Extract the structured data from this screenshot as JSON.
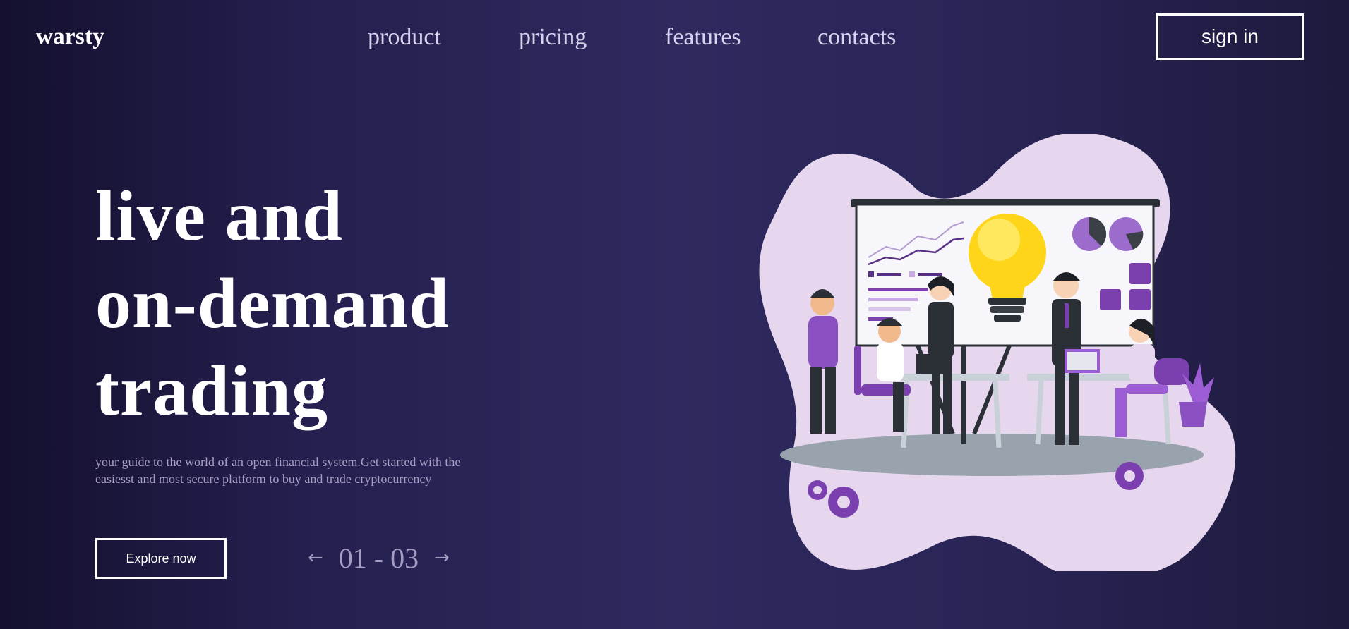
{
  "header": {
    "logo": "warsty",
    "nav": [
      "product",
      "pricing",
      "features",
      "contacts"
    ],
    "signin_label": "sign in"
  },
  "hero": {
    "title_lines": [
      "live and",
      "on-demand",
      "trading"
    ],
    "subtitle": "your guide to the world of an open financial system.Get started with the easiesst and most secure platform to buy and trade cryptocurrency",
    "explore_label": "Explore now",
    "pager": {
      "prev_icon": "arrow-left-icon",
      "next_icon": "arrow-right-icon",
      "counter": "01 - 03"
    }
  },
  "illustration": {
    "subject": "team-meeting-lightbulb-illustration",
    "colors": {
      "blob": "#e6d6ee",
      "accent": "#7b3fb0",
      "board": "#f7f7fb",
      "bulb": "#ffd51a"
    }
  },
  "colors": {
    "background_start": "#14102e",
    "background_mid": "#2e2a5f",
    "background_end": "#1d1a3d",
    "text_primary": "#ffffff",
    "text_muted": "#a79fc4",
    "nav_text": "#d8d2ee"
  }
}
